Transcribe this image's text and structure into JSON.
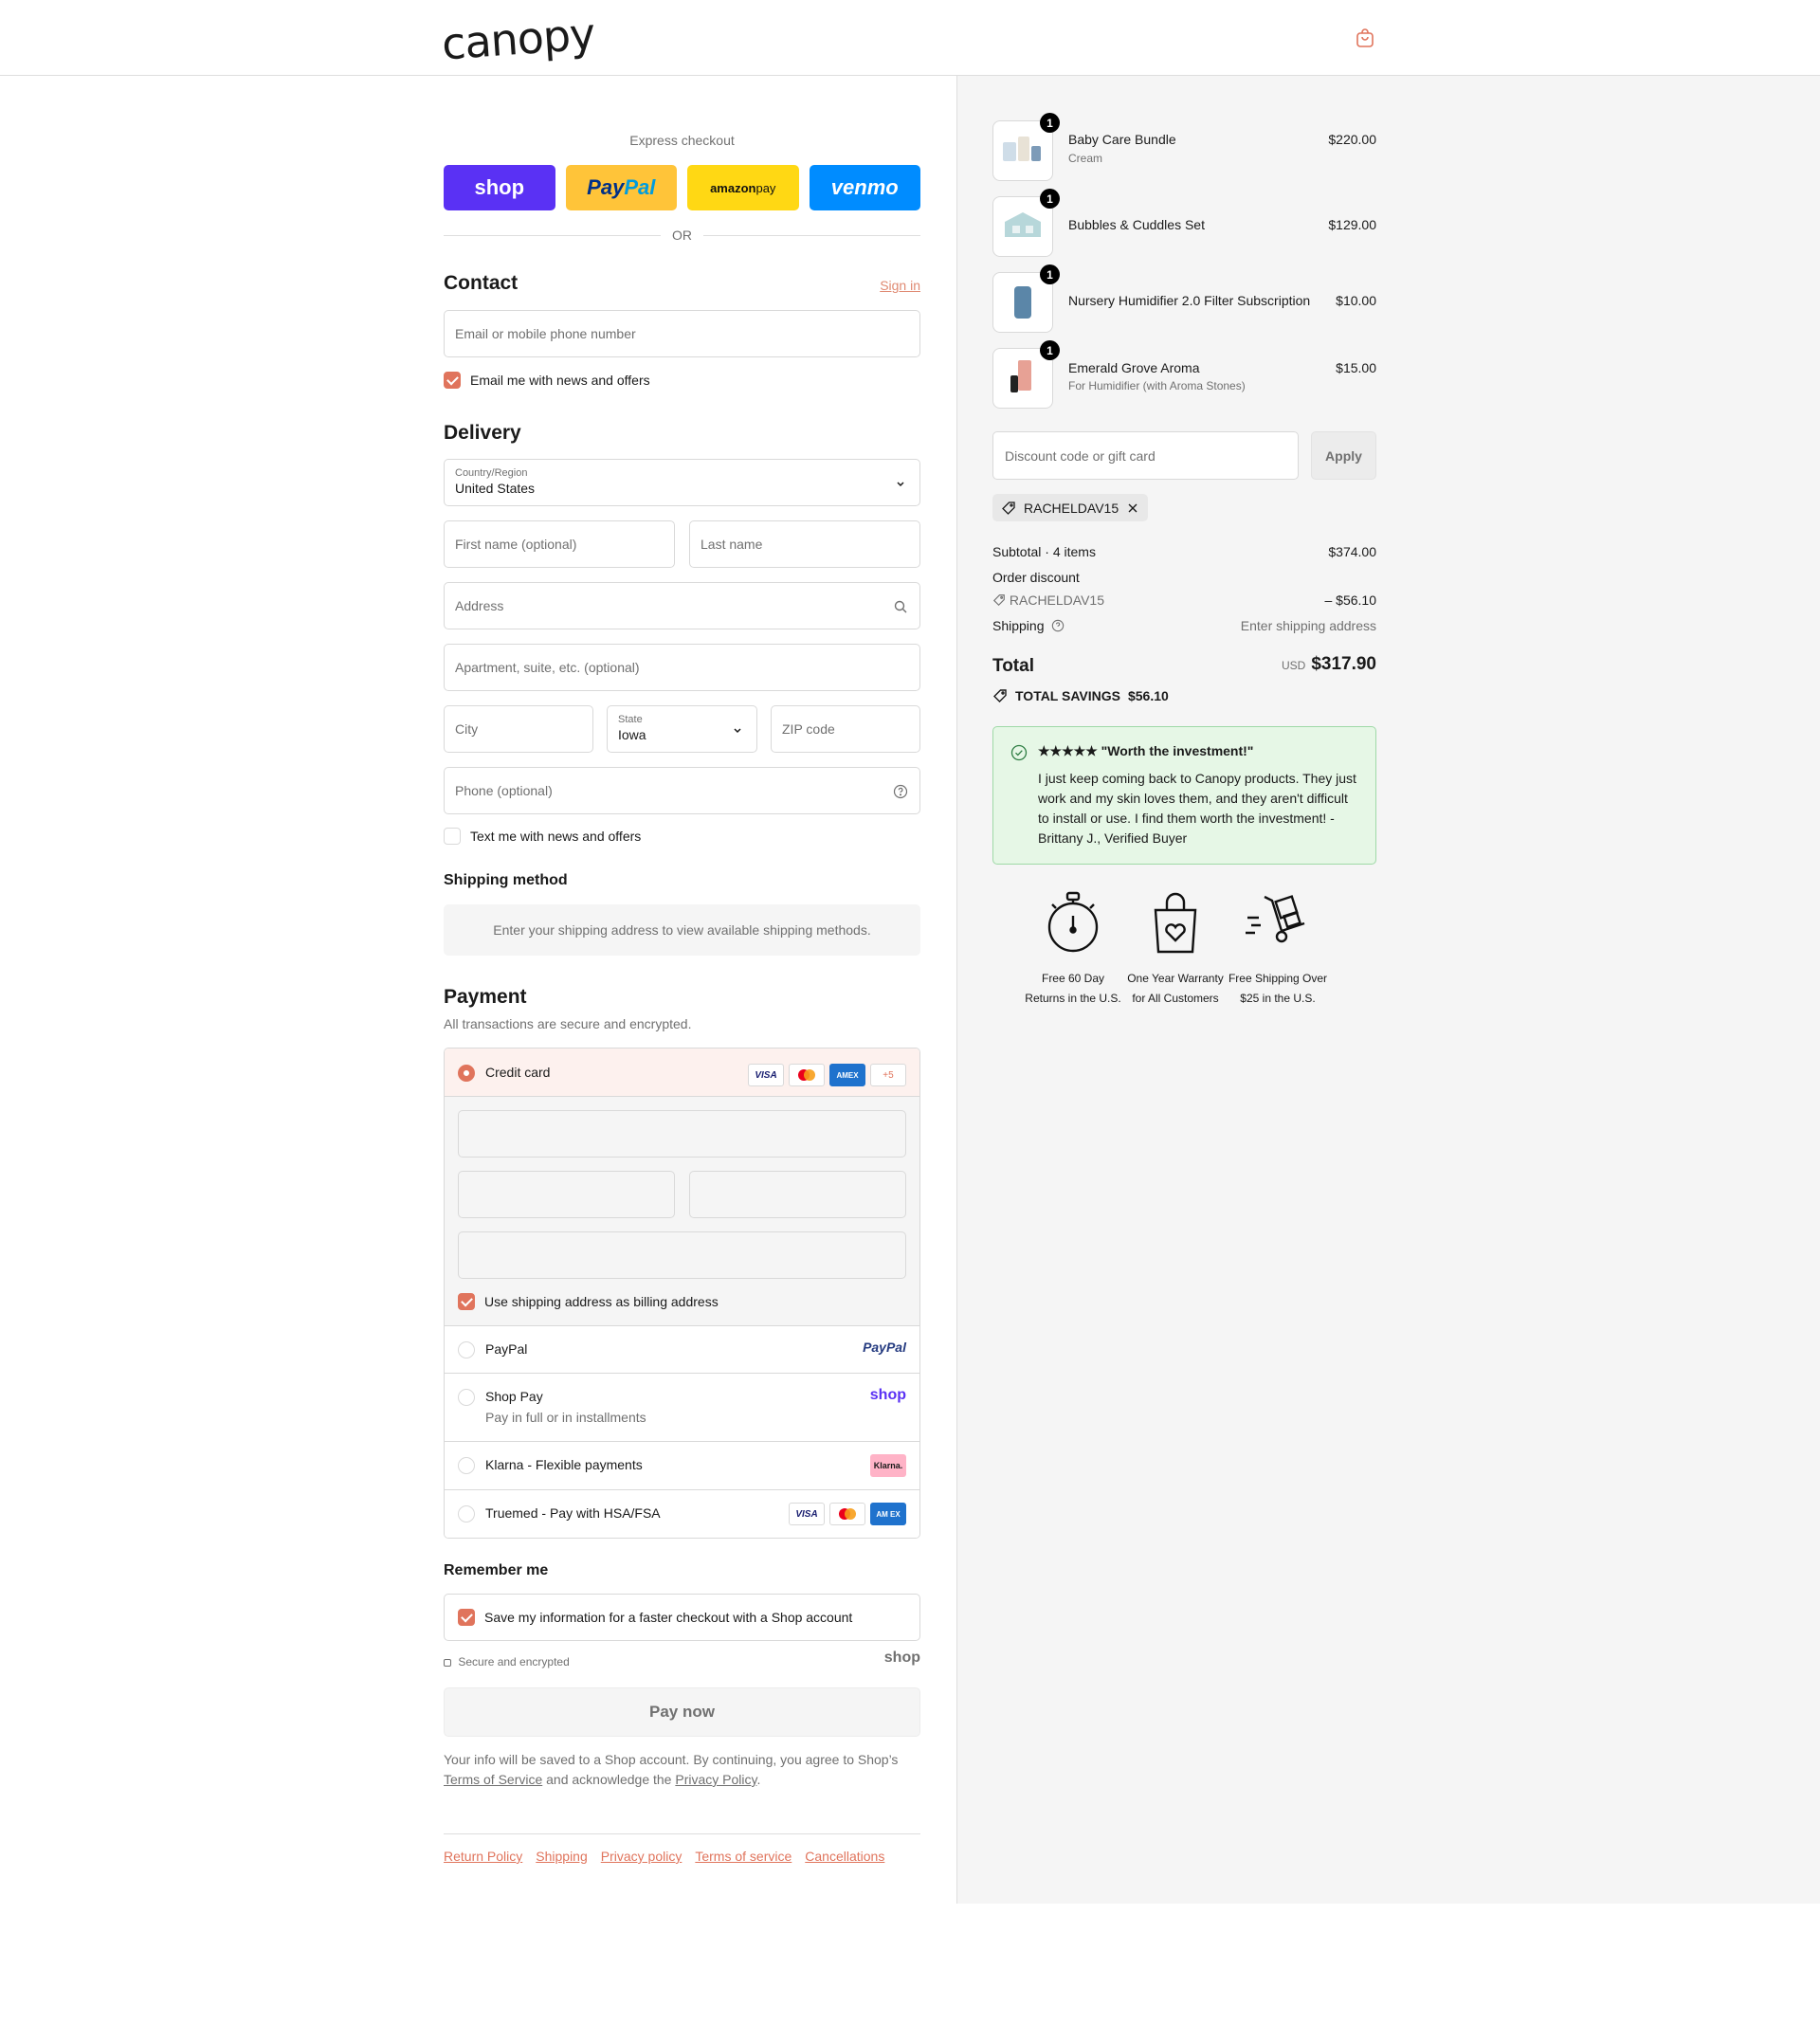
{
  "header": {
    "logo": "canopy",
    "cart_icon": "shopping-bag-icon"
  },
  "express": {
    "title": "Express checkout",
    "buttons": {
      "shop": "shop",
      "paypal_a": "Pay",
      "paypal_b": "Pal",
      "amazon_a": "amazon",
      "amazon_b": " pay",
      "venmo": "venmo"
    },
    "or": "OR"
  },
  "contact": {
    "title": "Contact",
    "sign_in": "Sign in",
    "email_placeholder": "Email or mobile phone number",
    "news_label": "Email me with news and offers",
    "news_checked": true
  },
  "delivery": {
    "title": "Delivery",
    "country_label": "Country/Region",
    "country_value": "United States",
    "first_name": "First name (optional)",
    "last_name": "Last name",
    "address": "Address",
    "apartment": "Apartment, suite, etc. (optional)",
    "city": "City",
    "state_label": "State",
    "state_value": "Iowa",
    "zip": "ZIP code",
    "phone": "Phone (optional)",
    "text_label": "Text me with news and offers",
    "text_checked": false
  },
  "shipping_method": {
    "title": "Shipping method",
    "message": "Enter your shipping address to view available shipping methods."
  },
  "payment": {
    "title": "Payment",
    "subtitle": "All transactions are secure and encrypted.",
    "credit_card": "Credit card",
    "card_icons": {
      "visa": "VISA",
      "amex": "AMEX",
      "more": "+5"
    },
    "billing_label": "Use shipping address as billing address",
    "paypal": "PayPal",
    "paypal_logo": "PayPal",
    "shop_pay": "Shop Pay",
    "shop_pay_sub": "Pay in full or in installments",
    "shop_logo": "shop",
    "klarna": "Klarna - Flexible payments",
    "klarna_logo": "Klarna.",
    "truemed": "Truemed - Pay with HSA/FSA",
    "truemed_amex": "AM EX"
  },
  "remember": {
    "title": "Remember me",
    "save_label": "Save my information for a faster checkout with a Shop account",
    "secure": "Secure and encrypted",
    "shop_logo": "shop"
  },
  "pay_now": "Pay now",
  "legal": {
    "line1": "Your info will be saved to a Shop account. By continuing, you agree to Shop’s",
    "tos": "Terms of Service",
    "mid": " and acknowledge the ",
    "privacy": "Privacy Policy",
    "end": "."
  },
  "footer": [
    "Return Policy",
    "Shipping",
    "Privacy policy",
    "Terms of service",
    "Cancellations"
  ],
  "order": {
    "items": [
      {
        "name": "Baby Care Bundle",
        "variant": "Cream",
        "price": "$220.00",
        "qty": "1"
      },
      {
        "name": "Bubbles & Cuddles Set",
        "variant": "",
        "price": "$129.00",
        "qty": "1"
      },
      {
        "name": "Nursery Humidifier 2.0 Filter Subscription",
        "variant": "",
        "price": "$10.00",
        "qty": "1"
      },
      {
        "name": "Emerald Grove Aroma",
        "variant": "For Humidifier (with Aroma Stones)",
        "price": "$15.00",
        "qty": "1"
      }
    ],
    "discount_placeholder": "Discount code or gift card",
    "apply": "Apply",
    "applied_code": "RACHELDAV15",
    "subtotal_label": "Subtotal · 4 items",
    "subtotal": "$374.00",
    "order_discount": "Order discount",
    "discount_code": "RACHELDAV15",
    "discount_amount": "– $56.10",
    "shipping_label": "Shipping",
    "shipping_value": "Enter shipping address",
    "total_label": "Total",
    "currency": "USD",
    "total": "$317.90",
    "savings_label": "TOTAL SAVINGS",
    "savings": "$56.10"
  },
  "review": {
    "title": "★★★★★ \"Worth the investment!\"",
    "body": "I just keep coming back to Canopy products. They just work and my skin loves them, and they aren't difficult to install or use. I find them worth the investment! - Brittany J., Verified Buyer"
  },
  "perks": [
    {
      "icon": "stopwatch-icon",
      "text": "Free 60 Day Returns in the U.S."
    },
    {
      "icon": "heart-bag-icon",
      "text": "One Year Warranty for All Customers"
    },
    {
      "icon": "delivery-cart-icon",
      "text": "Free Shipping Over $25 in the U.S."
    }
  ]
}
